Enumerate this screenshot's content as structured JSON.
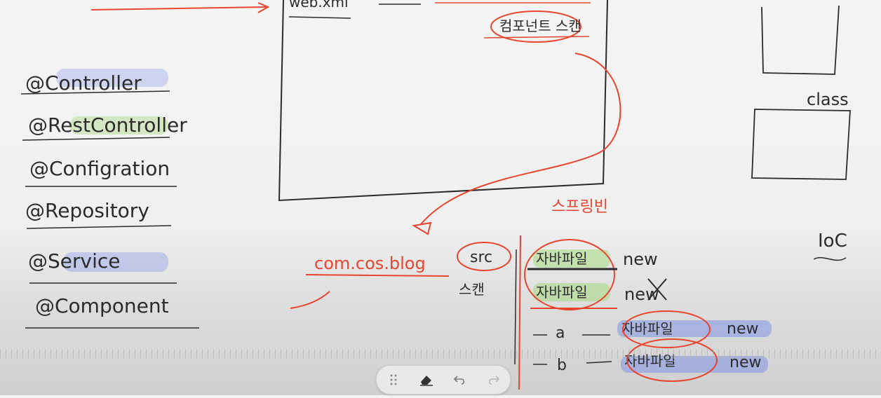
{
  "annotations": {
    "items": [
      "@Controller",
      "@RestController",
      "@Configration",
      "@Repository",
      "@Service",
      "@Component"
    ],
    "diagram": {
      "top_label": "web.xml",
      "component_scan": "컴포넌트 스캔",
      "class_label": "class",
      "ioc_label": "IoC",
      "package": "com.cos.blog",
      "src_label": "src",
      "scan_label": "스캔",
      "spring_beans": "스프링빈",
      "java_file": "자바파일",
      "new_label": "new",
      "a_label": "a",
      "b_label": "b"
    }
  },
  "toolbar": {
    "tools": [
      "drag-handle",
      "eraser",
      "undo",
      "redo"
    ]
  },
  "colors": {
    "ink": "#2b2b2b",
    "red_ink": "#e8452f",
    "highlight_blue": "#6f86e8",
    "highlight_green": "#9bd66a"
  }
}
